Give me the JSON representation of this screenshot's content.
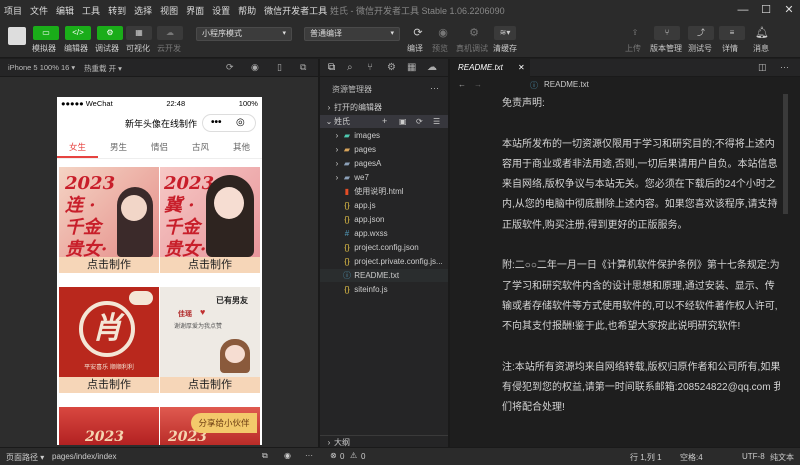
{
  "menubar": {
    "items": [
      "项目",
      "文件",
      "编辑",
      "工具",
      "转到",
      "选择",
      "视图",
      "界面",
      "设置",
      "帮助",
      "微信开发者工具"
    ],
    "title": "姓氏 - 微信开发者工具 Stable 1.06.2206090"
  },
  "toolbar": {
    "simulator": "模拟器",
    "editor": "编辑器",
    "debugger": "调试器",
    "visual": "可视化",
    "cloud": "云开发",
    "mode_select": "小程序模式",
    "compile_select": "普通编译",
    "compile": "编译",
    "preview": "预览",
    "remote_debug": "真机调试",
    "clear_cache": "清缓存",
    "upload": "上传",
    "version": "版本管理",
    "test": "测试号",
    "details": "详情",
    "messages": "消息"
  },
  "simulator": {
    "device": "iPhone 5 100% 16 ▾",
    "hotreload": "热重载 开 ▾",
    "status": {
      "carrier": "●●●●● WeChat",
      "time": "22:48",
      "battery": "100%"
    },
    "nav_title": "新年头像在线制作",
    "tabs": [
      "女生",
      "男生",
      "情侣",
      "古风",
      "其他"
    ],
    "active_tab": "女生",
    "card_button": "点击制作",
    "card1_text": "2023 连 ·千金贵女·",
    "card2_text": "2023 冀 ·千金贵女·",
    "card3_text": "肖",
    "card3_caption": "平安喜乐 顺顺利利",
    "card4_title": "已有男友",
    "card4_name": "佳瑶",
    "card4_caption": "谢谢厚爱为我点赞",
    "card5_text": "2023",
    "card6_text": "2023",
    "share_label": "分享给小伙伴"
  },
  "filemanager": {
    "title": "资源管理器",
    "open_editors": "打开的编辑器",
    "project": "姓氏",
    "items": [
      {
        "name": "images",
        "type": "folder",
        "icon": "folder-images-icon"
      },
      {
        "name": "pages",
        "type": "folder",
        "icon": "folder-icon"
      },
      {
        "name": "pagesA",
        "type": "folder",
        "icon": "folder-icon"
      },
      {
        "name": "we7",
        "type": "folder",
        "icon": "folder-icon"
      },
      {
        "name": "使用说明.html",
        "type": "html",
        "icon": "html-icon"
      },
      {
        "name": "app.js",
        "type": "js",
        "icon": "js-icon"
      },
      {
        "name": "app.json",
        "type": "json",
        "icon": "json-icon"
      },
      {
        "name": "app.wxss",
        "type": "wxss",
        "icon": "wxss-icon"
      },
      {
        "name": "project.config.json",
        "type": "json",
        "icon": "json-icon"
      },
      {
        "name": "project.private.config.js...",
        "type": "json",
        "icon": "json-icon"
      },
      {
        "name": "README.txt",
        "type": "txt",
        "icon": "info-icon"
      },
      {
        "name": "siteinfo.js",
        "type": "js",
        "icon": "js-icon"
      }
    ],
    "outline": "大纲",
    "status_errors": "0",
    "status_warnings": "0"
  },
  "editor": {
    "tab": "README.txt",
    "breadcrumb": "README.txt",
    "paragraphs": [
      "免责声明:",
      "",
      "本站所发布的一切资源仅限用于学习和研究目的;不得将上述内容用于商业或者非法用途,否则,一切后果请用户自负。本站信息来自网络,版权争议与本站无关。您必须在下载后的24个小时之内,从您的电脑中彻底删除上述内容。如果您喜欢该程序,请支持正版软件,购买注册,得到更好的正版服务。",
      "",
      "附:二○○二年一月一日《计算机软件保护条例》第十七条规定:为了学习和研究软件内含的设计思想和原理,通过安装、显示、传输或者存储软件等方式使用软件的,可以不经软件著作权人许可,不向其支付报酬!鉴于此,也希望大家按此说明研究软件!",
      "",
      "注:本站所有资源均来自网络转载,版权归原作者和公司所有,如果有侵犯到您的权益,请第一时间联系邮箱:208524822@qq.com 我们将配合处理!"
    ]
  },
  "statusbar": {
    "page_path_label": "页面路径 ▾",
    "page_path": "pages/index/index",
    "position": "行 1,列 1",
    "spaces": "空格:4",
    "encoding": "UTF-8",
    "lang": "纯文本"
  },
  "colors": {
    "accent_green": "#1aad19",
    "tab_red": "#e64340",
    "card_button": "#f6d6b8"
  }
}
